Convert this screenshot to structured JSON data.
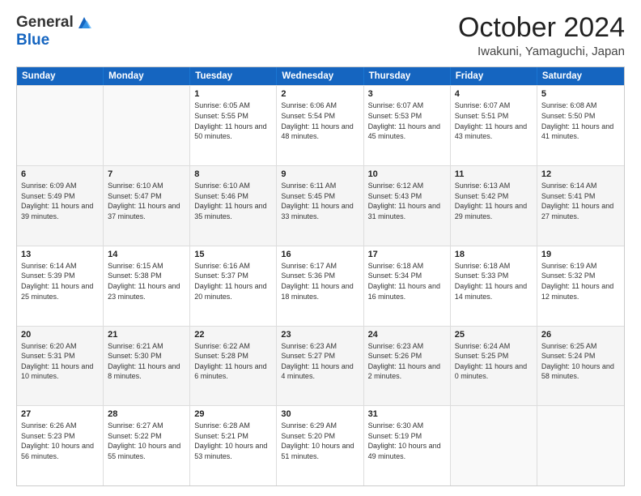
{
  "header": {
    "logo_general": "General",
    "logo_blue": "Blue",
    "month_title": "October 2024",
    "location": "Iwakuni, Yamaguchi, Japan"
  },
  "calendar": {
    "days_of_week": [
      "Sunday",
      "Monday",
      "Tuesday",
      "Wednesday",
      "Thursday",
      "Friday",
      "Saturday"
    ],
    "weeks": [
      [
        {
          "day": "",
          "text": ""
        },
        {
          "day": "",
          "text": ""
        },
        {
          "day": "1",
          "text": "Sunrise: 6:05 AM\nSunset: 5:55 PM\nDaylight: 11 hours and 50 minutes."
        },
        {
          "day": "2",
          "text": "Sunrise: 6:06 AM\nSunset: 5:54 PM\nDaylight: 11 hours and 48 minutes."
        },
        {
          "day": "3",
          "text": "Sunrise: 6:07 AM\nSunset: 5:53 PM\nDaylight: 11 hours and 45 minutes."
        },
        {
          "day": "4",
          "text": "Sunrise: 6:07 AM\nSunset: 5:51 PM\nDaylight: 11 hours and 43 minutes."
        },
        {
          "day": "5",
          "text": "Sunrise: 6:08 AM\nSunset: 5:50 PM\nDaylight: 11 hours and 41 minutes."
        }
      ],
      [
        {
          "day": "6",
          "text": "Sunrise: 6:09 AM\nSunset: 5:49 PM\nDaylight: 11 hours and 39 minutes."
        },
        {
          "day": "7",
          "text": "Sunrise: 6:10 AM\nSunset: 5:47 PM\nDaylight: 11 hours and 37 minutes."
        },
        {
          "day": "8",
          "text": "Sunrise: 6:10 AM\nSunset: 5:46 PM\nDaylight: 11 hours and 35 minutes."
        },
        {
          "day": "9",
          "text": "Sunrise: 6:11 AM\nSunset: 5:45 PM\nDaylight: 11 hours and 33 minutes."
        },
        {
          "day": "10",
          "text": "Sunrise: 6:12 AM\nSunset: 5:43 PM\nDaylight: 11 hours and 31 minutes."
        },
        {
          "day": "11",
          "text": "Sunrise: 6:13 AM\nSunset: 5:42 PM\nDaylight: 11 hours and 29 minutes."
        },
        {
          "day": "12",
          "text": "Sunrise: 6:14 AM\nSunset: 5:41 PM\nDaylight: 11 hours and 27 minutes."
        }
      ],
      [
        {
          "day": "13",
          "text": "Sunrise: 6:14 AM\nSunset: 5:39 PM\nDaylight: 11 hours and 25 minutes."
        },
        {
          "day": "14",
          "text": "Sunrise: 6:15 AM\nSunset: 5:38 PM\nDaylight: 11 hours and 23 minutes."
        },
        {
          "day": "15",
          "text": "Sunrise: 6:16 AM\nSunset: 5:37 PM\nDaylight: 11 hours and 20 minutes."
        },
        {
          "day": "16",
          "text": "Sunrise: 6:17 AM\nSunset: 5:36 PM\nDaylight: 11 hours and 18 minutes."
        },
        {
          "day": "17",
          "text": "Sunrise: 6:18 AM\nSunset: 5:34 PM\nDaylight: 11 hours and 16 minutes."
        },
        {
          "day": "18",
          "text": "Sunrise: 6:18 AM\nSunset: 5:33 PM\nDaylight: 11 hours and 14 minutes."
        },
        {
          "day": "19",
          "text": "Sunrise: 6:19 AM\nSunset: 5:32 PM\nDaylight: 11 hours and 12 minutes."
        }
      ],
      [
        {
          "day": "20",
          "text": "Sunrise: 6:20 AM\nSunset: 5:31 PM\nDaylight: 11 hours and 10 minutes."
        },
        {
          "day": "21",
          "text": "Sunrise: 6:21 AM\nSunset: 5:30 PM\nDaylight: 11 hours and 8 minutes."
        },
        {
          "day": "22",
          "text": "Sunrise: 6:22 AM\nSunset: 5:28 PM\nDaylight: 11 hours and 6 minutes."
        },
        {
          "day": "23",
          "text": "Sunrise: 6:23 AM\nSunset: 5:27 PM\nDaylight: 11 hours and 4 minutes."
        },
        {
          "day": "24",
          "text": "Sunrise: 6:23 AM\nSunset: 5:26 PM\nDaylight: 11 hours and 2 minutes."
        },
        {
          "day": "25",
          "text": "Sunrise: 6:24 AM\nSunset: 5:25 PM\nDaylight: 11 hours and 0 minutes."
        },
        {
          "day": "26",
          "text": "Sunrise: 6:25 AM\nSunset: 5:24 PM\nDaylight: 10 hours and 58 minutes."
        }
      ],
      [
        {
          "day": "27",
          "text": "Sunrise: 6:26 AM\nSunset: 5:23 PM\nDaylight: 10 hours and 56 minutes."
        },
        {
          "day": "28",
          "text": "Sunrise: 6:27 AM\nSunset: 5:22 PM\nDaylight: 10 hours and 55 minutes."
        },
        {
          "day": "29",
          "text": "Sunrise: 6:28 AM\nSunset: 5:21 PM\nDaylight: 10 hours and 53 minutes."
        },
        {
          "day": "30",
          "text": "Sunrise: 6:29 AM\nSunset: 5:20 PM\nDaylight: 10 hours and 51 minutes."
        },
        {
          "day": "31",
          "text": "Sunrise: 6:30 AM\nSunset: 5:19 PM\nDaylight: 10 hours and 49 minutes."
        },
        {
          "day": "",
          "text": ""
        },
        {
          "day": "",
          "text": ""
        }
      ]
    ]
  }
}
